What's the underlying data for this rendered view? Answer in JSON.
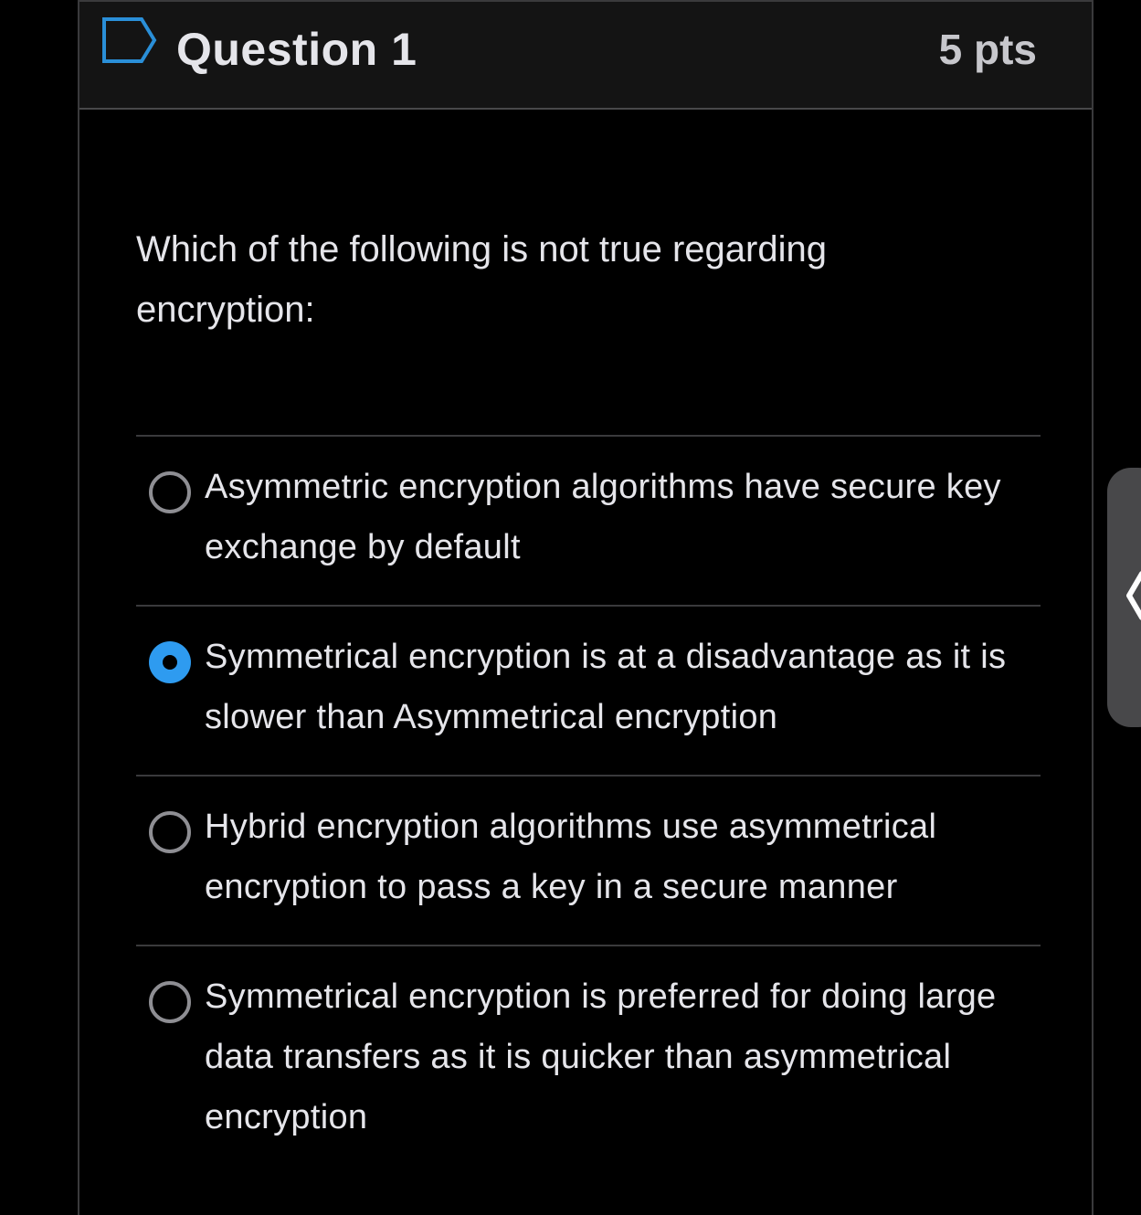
{
  "question": {
    "title": "Question 1",
    "points": "5 pts",
    "text": "Which of the following is not true regarding encryption:",
    "flag_icon": "flag-outline-icon"
  },
  "answers": [
    {
      "label": "Asymmetric encryption algorithms have secure key exchange by default",
      "selected": false
    },
    {
      "label": "Symmetrical encryption is at a disadvantage as it is slower than Asymmetrical encryption",
      "selected": true
    },
    {
      "label": "Hybrid encryption algorithms use asymmetrical encryption to pass a key in a secure manner",
      "selected": false
    },
    {
      "label": "Symmetrical encryption is preferred for doing large data transfers as it is quicker than asymmetrical encryption",
      "selected": false
    }
  ],
  "colors": {
    "background": "#000000",
    "header_background": "#141414",
    "accent_selected": "#2e9bf0",
    "text": "#e5e5ea",
    "divider": "#3a3a3c",
    "side_tab": "#48484a"
  },
  "side_tab": {
    "icon": "chevron-left-icon"
  }
}
